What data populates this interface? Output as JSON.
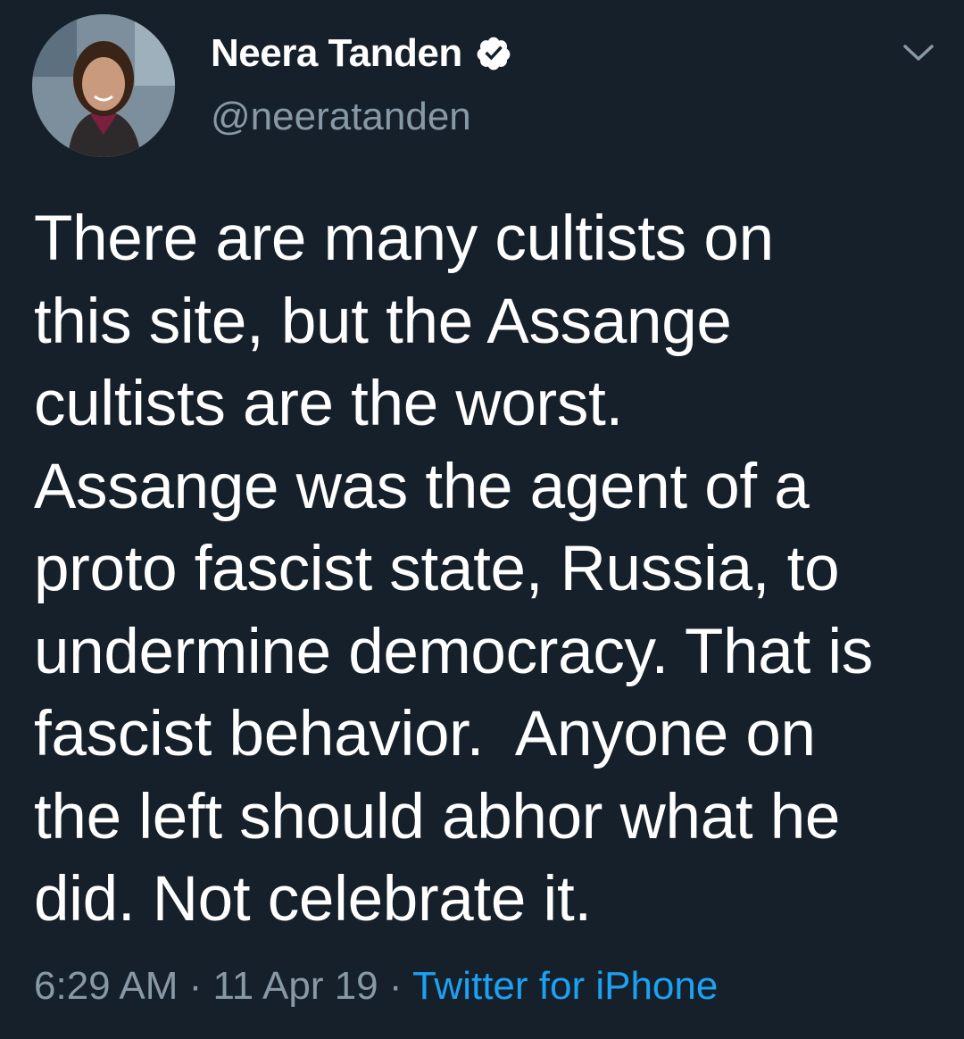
{
  "author": {
    "display_name": "Neera Tanden",
    "handle": "@neeratanden",
    "verified": true
  },
  "tweet": {
    "lines": [
      "There are many cultists on",
      "this site, but the Assange",
      "cultists are the worst.",
      "Assange was the agent of a",
      "proto fascist state, Russia, to",
      "undermine democracy. That is",
      "fascist behavior.  Anyone on",
      "the left should abhor what he",
      "did. Not celebrate it."
    ]
  },
  "meta": {
    "time": "6:29 AM",
    "separator": " · ",
    "date": "11 Apr 19",
    "source": "Twitter for iPhone"
  },
  "icons": {
    "verified": "verified-badge-icon",
    "menu": "chevron-down-icon"
  },
  "colors": {
    "background": "#15202b",
    "secondary_text": "#8899a6",
    "link": "#1da1f2"
  }
}
